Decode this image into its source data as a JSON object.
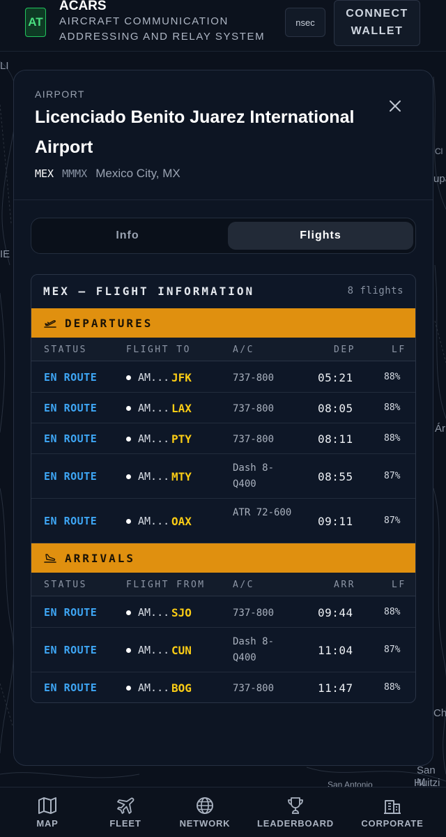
{
  "header": {
    "logo": "AT",
    "title": "ACARS",
    "subtitle": "AIRCRAFT COMMUNICATION ADDRESSING AND RELAY SYSTEM",
    "nsec_label": "nsec",
    "connect_label": "CONNECT WALLET"
  },
  "map_labels": [
    "LI",
    "IE",
    "San M",
    "Huitzi",
    "Ch",
    "upa",
    "Ár",
    "Cl",
    "San Antonio"
  ],
  "panel": {
    "eyebrow": "AIRPORT",
    "name": "Licenciado Benito Juarez International Airport",
    "iata": "MEX",
    "icao": "MMMX",
    "city": "Mexico City, MX",
    "close_icon": "close-icon",
    "tabs": [
      {
        "label": "Info",
        "active": false
      },
      {
        "label": "Flights",
        "active": true
      }
    ]
  },
  "board": {
    "title": "MEX — FLIGHT INFORMATION",
    "count": "8 flights",
    "departures": {
      "label": "DEPARTURES",
      "icon": "takeoff-icon",
      "columns": {
        "status": "STATUS",
        "flight": "FLIGHT TO",
        "ac": "A/C",
        "time": "DEP",
        "lf": "LF"
      },
      "rows": [
        {
          "status": "EN ROUTE",
          "flight": "AM...",
          "airport": "JFK",
          "ac": "737-800",
          "time": "05:21",
          "lf": "88%"
        },
        {
          "status": "EN ROUTE",
          "flight": "AM...",
          "airport": "LAX",
          "ac": "737-800",
          "time": "08:05",
          "lf": "88%"
        },
        {
          "status": "EN ROUTE",
          "flight": "AM...",
          "airport": "PTY",
          "ac": "737-800",
          "time": "08:11",
          "lf": "88%"
        },
        {
          "status": "EN ROUTE",
          "flight": "AM...",
          "airport": "MTY",
          "ac": "Dash 8-Q400",
          "time": "08:55",
          "lf": "87%"
        },
        {
          "status": "EN ROUTE",
          "flight": "AM...",
          "airport": "OAX",
          "ac": "ATR 72-600",
          "time": "09:11",
          "lf": "87%"
        }
      ]
    },
    "arrivals": {
      "label": "ARRIVALS",
      "icon": "landing-icon",
      "columns": {
        "status": "STATUS",
        "flight": "FLIGHT FROM",
        "ac": "A/C",
        "time": "ARR",
        "lf": "LF"
      },
      "rows": [
        {
          "status": "EN ROUTE",
          "flight": "AM...",
          "airport": "SJO",
          "ac": "737-800",
          "time": "09:44",
          "lf": "88%"
        },
        {
          "status": "EN ROUTE",
          "flight": "AM...",
          "airport": "CUN",
          "ac": "Dash 8-Q400",
          "time": "11:04",
          "lf": "87%"
        },
        {
          "status": "EN ROUTE",
          "flight": "AM...",
          "airport": "BOG",
          "ac": "737-800",
          "time": "11:47",
          "lf": "88%"
        }
      ]
    }
  },
  "nav": [
    {
      "label": "MAP",
      "icon": "map-icon"
    },
    {
      "label": "FLEET",
      "icon": "plane-icon"
    },
    {
      "label": "NETWORK",
      "icon": "globe-icon"
    },
    {
      "label": "LEADERBOARD",
      "icon": "trophy-icon"
    },
    {
      "label": "CORPORATE",
      "icon": "building-icon"
    }
  ]
}
